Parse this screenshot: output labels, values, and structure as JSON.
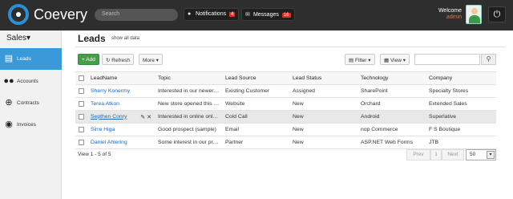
{
  "header": {
    "brand": "Coevery",
    "search_placeholder": "Search",
    "notifications": {
      "label": "Notifications",
      "count": "4"
    },
    "messages": {
      "label": "Messages",
      "count": "16"
    },
    "welcome": "Welcome",
    "user": "admin"
  },
  "sidebar": {
    "section": "Sales",
    "items": [
      {
        "label": "Leads",
        "icon": "leads-icon",
        "active": true
      },
      {
        "label": "Accounts",
        "icon": "people-icon"
      },
      {
        "label": "Contracts",
        "icon": "target-icon"
      },
      {
        "label": "Invoices",
        "icon": "globe-icon"
      }
    ]
  },
  "main": {
    "title": "Leads",
    "show_all": "show all data",
    "toolbar": {
      "add": "+ Add",
      "refresh": "Refresh",
      "more": "More",
      "filter": "Filter",
      "view": "View"
    },
    "columns": [
      "LeadName",
      "Topic",
      "Lead Source",
      "Lead Status",
      "Technology",
      "Company"
    ],
    "rows": [
      [
        "Sherry Konermy",
        "Interested in our newer…",
        "Existing Customer",
        "Assigned",
        "SharePoint",
        "Specialty Stores"
      ],
      [
        "Terea Atkon",
        "New store opened this …",
        "Website",
        "New",
        "Orchard",
        "Extended Sales"
      ],
      [
        "Septhen Conry",
        "Interested in online onl…",
        "Cold Call",
        "New",
        "Android",
        "Superlative"
      ],
      [
        "Sirre Higa",
        "Good prospect (sample)",
        "Email",
        "New",
        "nop Commerce",
        "F S Boutique"
      ],
      [
        "Daniel Ahlering",
        "Some interest in our pr…",
        "Partner",
        "New",
        "ASP.NET Web Forms",
        "JTB"
      ]
    ],
    "footer": {
      "summary": "View 1 - 5 of 5",
      "prev": "Prev",
      "page": "1",
      "next": "Next",
      "page_size": "50"
    }
  }
}
